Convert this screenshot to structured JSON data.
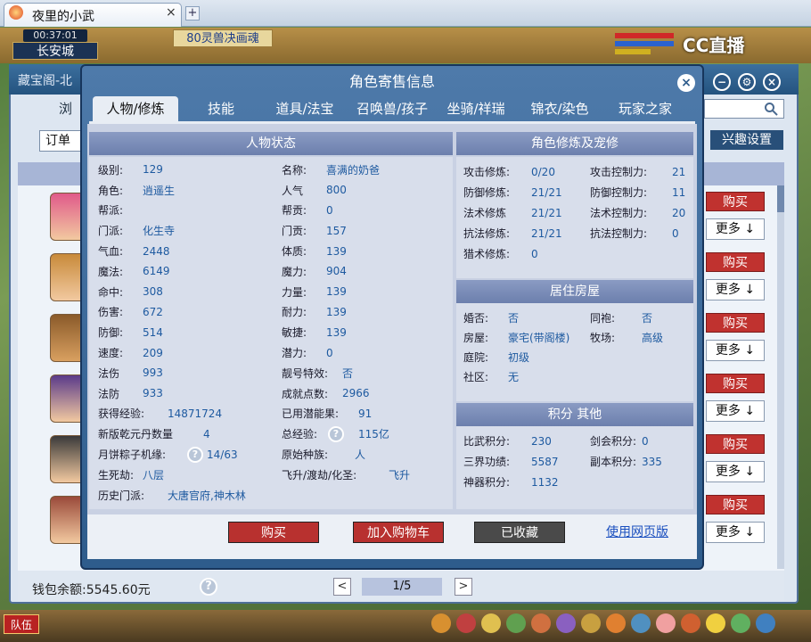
{
  "browser": {
    "tab_title": "夜里的小武",
    "close": "×",
    "add": "+"
  },
  "hud": {
    "clock": "00:37:01",
    "city": "长安城",
    "banner": "80灵兽决画魂",
    "cc_logo": "CC直播"
  },
  "store": {
    "title": "藏宝阁-北",
    "tab_partial": "浏",
    "filter_partial": "订单",
    "interest_button": "兴趣设置",
    "buy_label": "购买",
    "more_label": "更多 ↓",
    "wallet_label": "钱包余额:",
    "wallet_value": "5545.60元",
    "help": "?",
    "page": "1/5",
    "prev": "<",
    "next": ">"
  },
  "popup": {
    "title": "角色寄售信息",
    "close": "×",
    "window_buttons": [
      "−",
      "⚙",
      "×"
    ],
    "tabs": [
      "人物/修炼",
      "技能",
      "道具/法宝",
      "召唤兽/孩子",
      "坐骑/祥瑞",
      "锦衣/染色",
      "玩家之家"
    ],
    "status_title": "人物状态",
    "left_col": [
      {
        "label": "级别:",
        "value": "129"
      },
      {
        "label": "角色:",
        "value": "逍遥生"
      },
      {
        "label": "帮派:",
        "value": ""
      },
      {
        "label": "门派:",
        "value": "化生寺"
      },
      {
        "label": "气血:",
        "value": "2448"
      },
      {
        "label": "魔法:",
        "value": "6149"
      },
      {
        "label": "命中:",
        "value": "308"
      },
      {
        "label": "伤害:",
        "value": "672"
      },
      {
        "label": "防御:",
        "value": "514"
      },
      {
        "label": "速度:",
        "value": "209"
      },
      {
        "label": "法伤",
        "value": "993"
      },
      {
        "label": "法防",
        "value": "933"
      },
      {
        "label": "获得经验:",
        "value": "14871724"
      },
      {
        "label": "新版乾元丹数量",
        "value": "4"
      },
      {
        "label": "月饼粽子机缘:",
        "value": "14/63"
      },
      {
        "label": "生死劫:",
        "value": "八层"
      },
      {
        "label": "历史门派:",
        "value": "大唐官府,神木林"
      }
    ],
    "mid_col": [
      {
        "label": "名称:",
        "value": "喜满的奶爸"
      },
      {
        "label": "人气",
        "value": "800"
      },
      {
        "label": "帮贡:",
        "value": "0"
      },
      {
        "label": "门贡:",
        "value": "157"
      },
      {
        "label": "体质:",
        "value": "139"
      },
      {
        "label": "魔力:",
        "value": "904"
      },
      {
        "label": "力量:",
        "value": "139"
      },
      {
        "label": "耐力:",
        "value": "139"
      },
      {
        "label": "敏捷:",
        "value": "139"
      },
      {
        "label": "潜力:",
        "value": "0"
      },
      {
        "label": "靓号特效:",
        "value": "否"
      },
      {
        "label": "成就点数:",
        "value": "2966"
      },
      {
        "label": "已用潜能果:",
        "value": "91"
      },
      {
        "label": "总经验:",
        "value": "115亿"
      },
      {
        "label": "原始种族:",
        "value": "人"
      },
      {
        "label": "飞升/渡劫/化圣:",
        "value": "飞升"
      }
    ],
    "cultivation_title": "角色修炼及宠修",
    "cultivation_left": [
      {
        "label": "攻击修炼:",
        "value": "0/20"
      },
      {
        "label": "防御修炼:",
        "value": "21/21"
      },
      {
        "label": "法术修炼",
        "value": "21/21"
      },
      {
        "label": "抗法修炼:",
        "value": "21/21"
      },
      {
        "label": "猎术修炼:",
        "value": "0"
      }
    ],
    "cultivation_right": [
      {
        "label": "攻击控制力:",
        "value": "21"
      },
      {
        "label": "防御控制力:",
        "value": "11"
      },
      {
        "label": "法术控制力:",
        "value": "20"
      },
      {
        "label": "抗法控制力:",
        "value": "0"
      }
    ],
    "house_title": "居住房屋",
    "house": [
      {
        "label": "婚否:",
        "value": "否",
        "label2": "同袍:",
        "value2": "否"
      },
      {
        "label": "房屋:",
        "value": "豪宅(带阁楼)",
        "label2": "牧场:",
        "value2": "高级"
      },
      {
        "label": "庭院:",
        "value": "初级"
      },
      {
        "label": "社区:",
        "value": "无"
      }
    ],
    "points_title": "积分 其他",
    "points": [
      {
        "label": "比武积分:",
        "value": "230",
        "label2": "剑会积分:",
        "value2": "0"
      },
      {
        "label": "三界功绩:",
        "value": "5587",
        "label2": "副本积分:",
        "value2": "335"
      },
      {
        "label": "神器积分:",
        "value": "1132"
      }
    ],
    "actions": {
      "buy": "购买",
      "cart": "加入购物车",
      "fav": "已收藏",
      "web": "使用网页版"
    },
    "help": "?"
  },
  "bottom": {
    "team": "队伍"
  }
}
